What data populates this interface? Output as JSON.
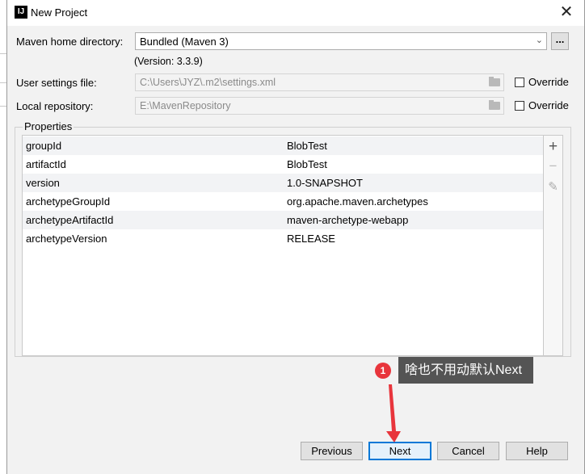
{
  "window": {
    "title": "New Project",
    "app_icon": "IJ"
  },
  "maven": {
    "home_label": "Maven home directory:",
    "home_value": "Bundled (Maven 3)",
    "version_text": "(Version: 3.3.9)",
    "settings_label": "User settings file:",
    "settings_value": "C:\\Users\\JYZ\\.m2\\settings.xml",
    "repo_label": "Local repository:",
    "repo_value": "E:\\MavenRepository",
    "override_label": "Override"
  },
  "properties": {
    "title": "Properties",
    "rows": [
      {
        "key": "groupId",
        "value": "BlobTest"
      },
      {
        "key": "artifactId",
        "value": "BlobTest"
      },
      {
        "key": "version",
        "value": "1.0-SNAPSHOT"
      },
      {
        "key": "archetypeGroupId",
        "value": "org.apache.maven.archetypes"
      },
      {
        "key": "archetypeArtifactId",
        "value": "maven-archetype-webapp"
      },
      {
        "key": "archetypeVersion",
        "value": "RELEASE"
      }
    ]
  },
  "annotation": {
    "badge": "1",
    "text": "啥也不用动默认Next"
  },
  "buttons": {
    "previous": "Previous",
    "next": "Next",
    "cancel": "Cancel",
    "help": "Help"
  },
  "colors": {
    "primary_border": "#0078d7",
    "badge": "#e8353c",
    "tooltip_bg": "#545454"
  }
}
